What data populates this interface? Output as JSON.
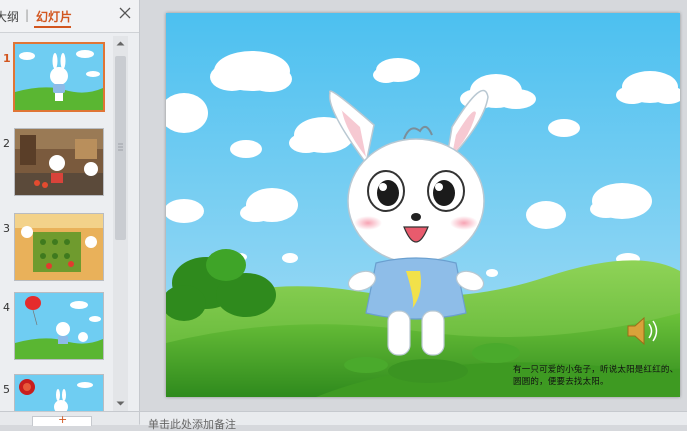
{
  "panel": {
    "tab_outline": "大纲",
    "tab_separator": "|",
    "tab_slides": "幻灯片"
  },
  "thumbnails": [
    {
      "number": "1",
      "active": true
    },
    {
      "number": "2",
      "active": false
    },
    {
      "number": "3",
      "active": false
    },
    {
      "number": "4",
      "active": false
    },
    {
      "number": "5",
      "active": false
    }
  ],
  "slide": {
    "caption": "有一只可爱的小兔子，听说太阳是红红的、圆圆的，便要去找太阳。"
  },
  "add_slide": {
    "label": "+"
  },
  "notes": {
    "placeholder": "单击此处添加备注"
  },
  "colors": {
    "accent": "#d2561f",
    "sky": "#5ac4f0",
    "grass": "#4aa52c"
  }
}
